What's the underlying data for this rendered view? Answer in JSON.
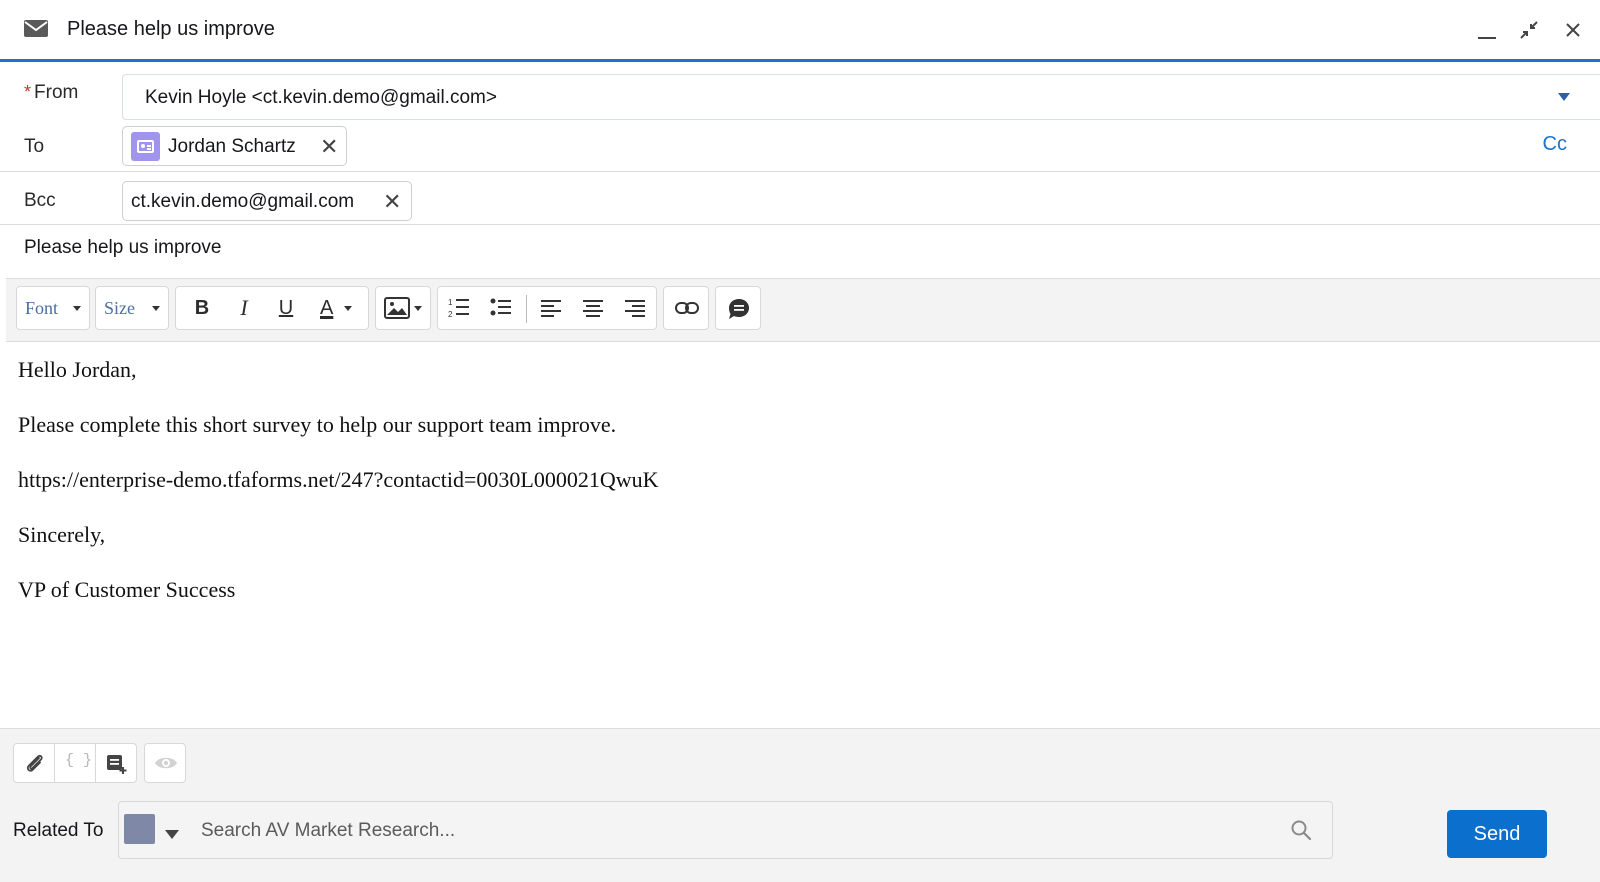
{
  "header": {
    "title": "Please help us improve",
    "icons": [
      "mail-icon",
      "minimize-icon",
      "collapse-icon",
      "close-icon"
    ]
  },
  "from": {
    "label": "From",
    "required_marker": "*",
    "value": "Kevin Hoyle <ct.kevin.demo@gmail.com>"
  },
  "to": {
    "label": "To",
    "recipient": "Jordan Schartz",
    "cc_link": "Cc"
  },
  "bcc": {
    "label": "Bcc",
    "recipient": "ct.kevin.demo@gmail.com"
  },
  "subject": "Please help us improve",
  "toolbar": {
    "font_label": "Font",
    "size_label": "Size",
    "bold": "B",
    "italic": "I",
    "underline": "U",
    "text_color": "A"
  },
  "body": {
    "greeting": "Hello Jordan,",
    "paragraph": "Please complete this short survey to help our support team improve.",
    "link": "https://enterprise-demo.tfaforms.net/247?contactid=0030L000021QwuK",
    "closing": "Sincerely,",
    "signature": "VP of Customer Success"
  },
  "footer": {
    "related_label": "Related To",
    "search_placeholder": "Search AV Market Research...",
    "send_label": "Send"
  },
  "colors": {
    "accent": "#1b73cc",
    "send_button": "#0b6fce",
    "required": "#c23934",
    "contact_icon": "#a094ed"
  }
}
